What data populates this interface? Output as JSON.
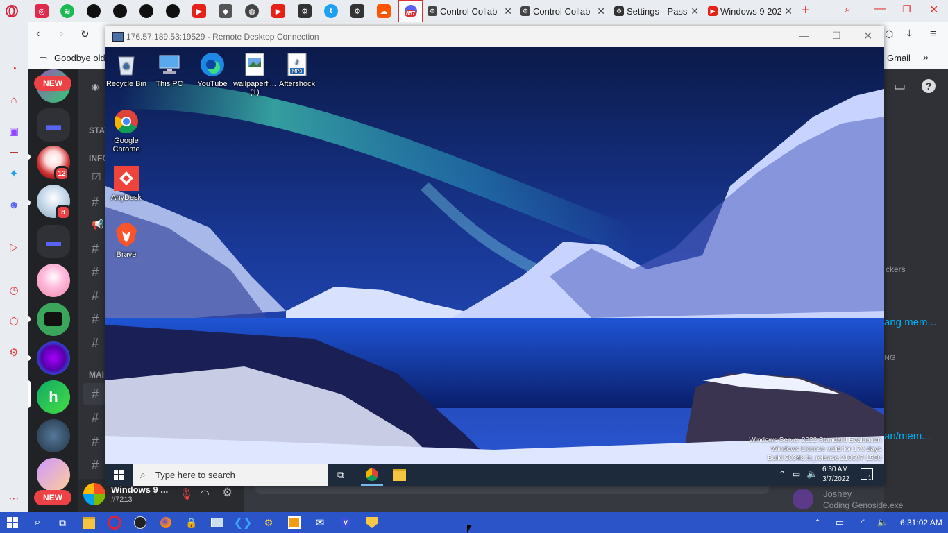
{
  "browser": {
    "tabs": [
      {
        "label": "Control Collab"
      },
      {
        "label": "Control Collab"
      },
      {
        "label": "Settings - Pass"
      },
      {
        "label": "Windows 9 202"
      }
    ],
    "tab_badge": "857",
    "bookmark": "Goodbye old",
    "bookmark_right": "Gmail",
    "new_tab_icon": "+"
  },
  "discord": {
    "new_badge_top": "NEW",
    "new_badge_bottom": "NEW",
    "server_badges": [
      "12",
      "8"
    ],
    "categories": [
      "STAT",
      "INFO",
      "MAI"
    ],
    "username": "Windows 9 ...",
    "discriminator": "#7213",
    "member_snippets": [
      "ckers",
      "ang mem...",
      "NG",
      "an/mem..."
    ],
    "activity_user": "Joshey",
    "activity_text": "Coding Genoside.exe"
  },
  "rdp": {
    "title": "176.57.189.53:19529 - Remote Desktop Connection",
    "desktop_icons": [
      {
        "label": "Recycle Bin"
      },
      {
        "label": "This PC"
      },
      {
        "label": "YouTube"
      },
      {
        "label": "wallpaperfl... (1)"
      },
      {
        "label": "Aftershock"
      },
      {
        "label": "Google Chrome"
      },
      {
        "label": "AnyDesk"
      },
      {
        "label": "Brave"
      }
    ],
    "watermark": [
      "Windows Server 2022 Standard Evaluation",
      "Windows License valid for 179 days",
      "Build 20348.fe_release.210507-1500"
    ],
    "search_placeholder": "Type here to search",
    "clock_time": "6:30 AM",
    "clock_date": "3/7/2022",
    "notif_count": "1"
  },
  "taskbar": {
    "clock": "6:31:02 AM"
  },
  "colors": {
    "discord_dark": "#202225",
    "discord_panel": "#2f3136",
    "windows_taskbar": "#2b54c9",
    "accent_red": "#ed4245"
  }
}
